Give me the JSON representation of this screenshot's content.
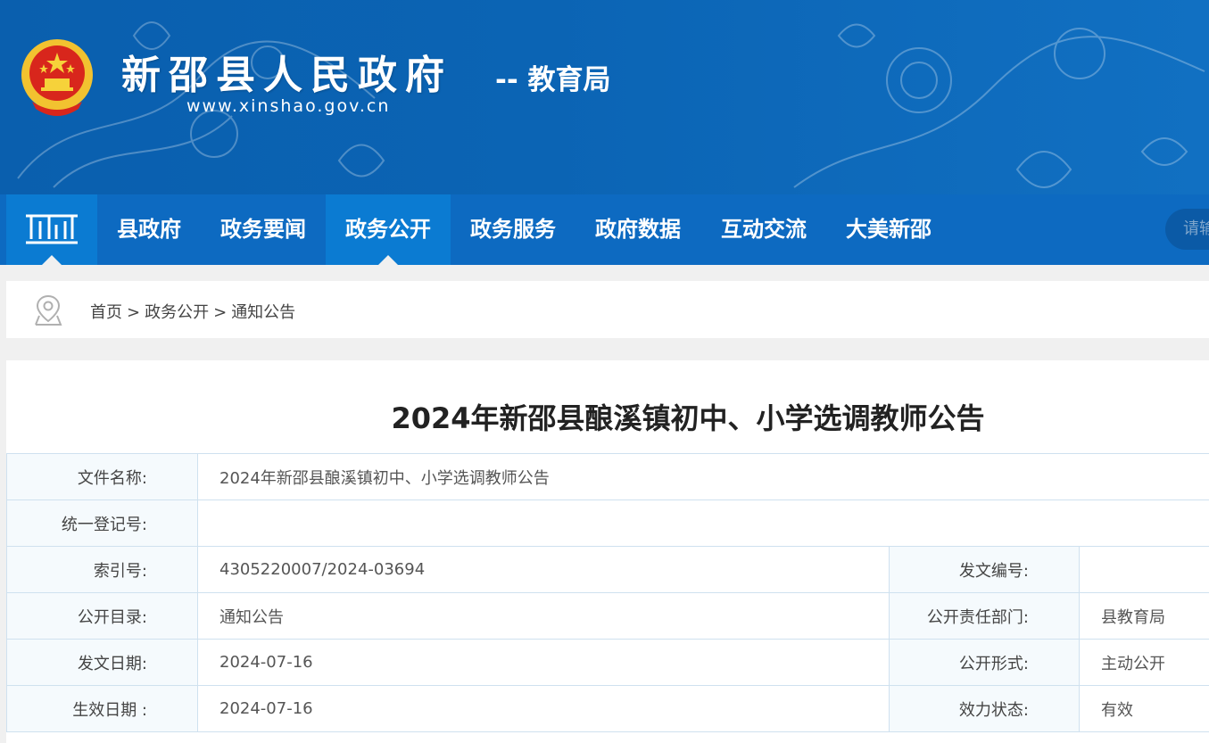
{
  "header": {
    "title": "新邵县人民政府",
    "url": "www.xinshao.gov.cn",
    "subtitle": "-- 教育局",
    "emblem_icon": "national-emblem-icon"
  },
  "nav": {
    "home_icon": "building-home-icon",
    "items": [
      {
        "label": "县政府"
      },
      {
        "label": "政务要闻"
      },
      {
        "label": "政务公开"
      },
      {
        "label": "政务服务"
      },
      {
        "label": "政府数据"
      },
      {
        "label": "互动交流"
      },
      {
        "label": "大美新邵"
      }
    ],
    "active_label": "政务公开",
    "search_placeholder": "请输"
  },
  "breadcrumb": {
    "icon": "location-pin-icon",
    "items": [
      "首页",
      "政务公开",
      "通知公告"
    ],
    "separator": ">"
  },
  "document": {
    "title": "2024年新邵县酿溪镇初中、小学选调教师公告",
    "meta": {
      "file_name_label": "文件名称:",
      "file_name_value": "2024年新邵县酿溪镇初中、小学选调教师公告",
      "reg_no_label": "统一登记号:",
      "reg_no_value": "",
      "index_label": "索引号:",
      "index_value": "4305220007/2024-03694",
      "doc_no_label": "发文编号:",
      "doc_no_value": "",
      "catalog_label": "公开目录:",
      "catalog_value": "通知公告",
      "dept_label": "公开责任部门:",
      "dept_value": "县教育局",
      "issue_date_label": "发文日期:",
      "issue_date_value": "2024-07-16",
      "form_label": "公开形式:",
      "form_value": "主动公开",
      "effective_date_label": "生效日期 :",
      "effective_date_value": "2024-07-16",
      "status_label": "效力状态:",
      "status_value": "有效"
    }
  },
  "colors": {
    "banner": "#0b64b4",
    "nav": "#0d6ac1",
    "nav_active": "#0b7bd2",
    "table_border": "#cfe1ef",
    "table_label_bg": "#f5fafd"
  }
}
